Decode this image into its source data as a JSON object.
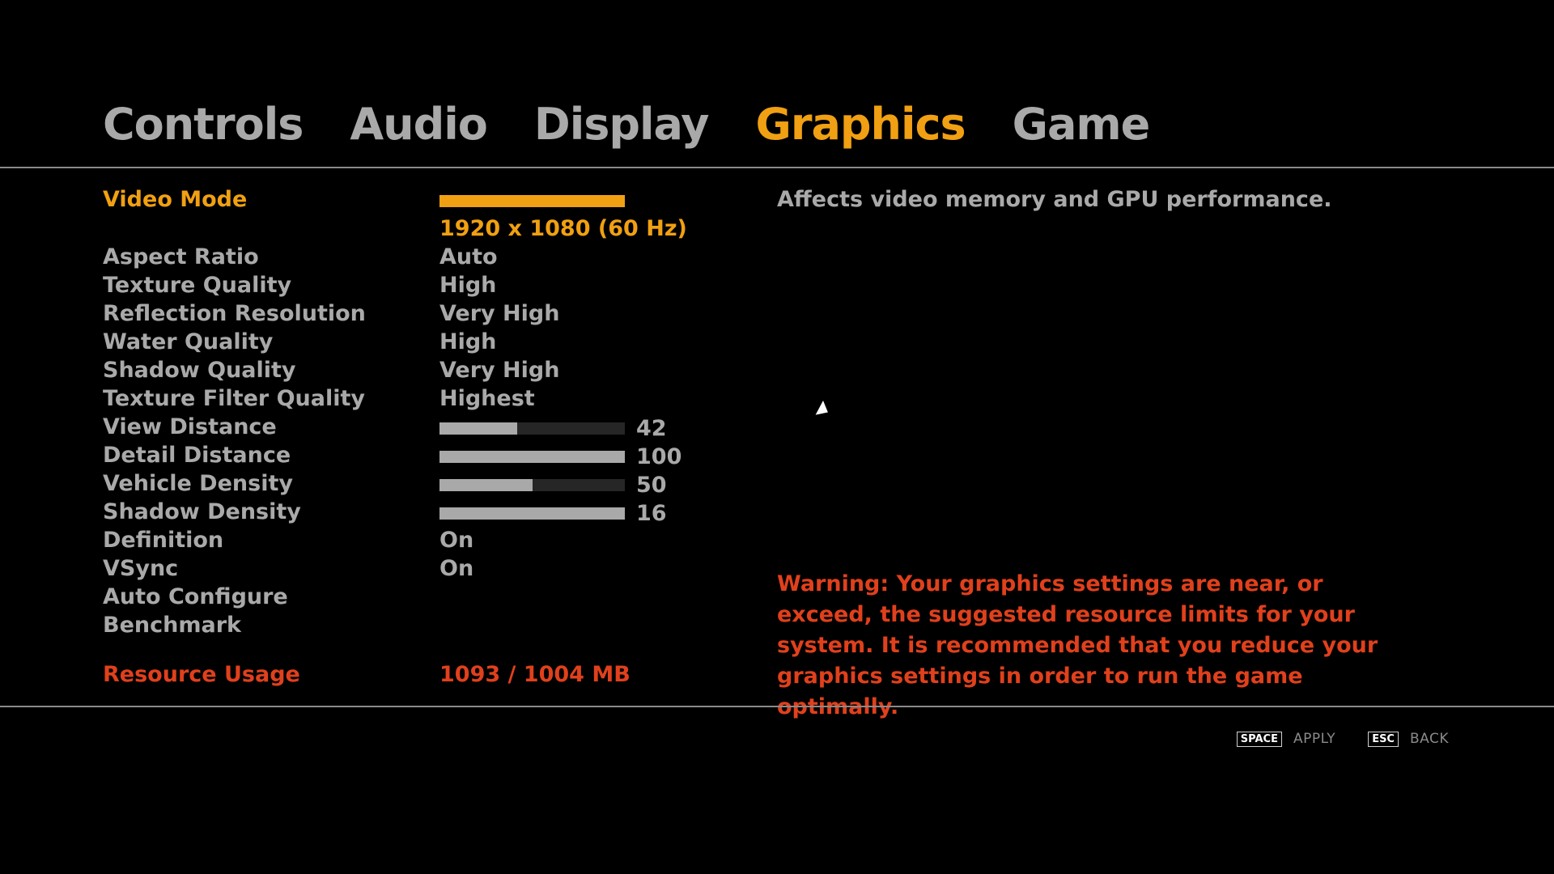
{
  "tabs": [
    {
      "label": "Controls",
      "active": false
    },
    {
      "label": "Audio",
      "active": false
    },
    {
      "label": "Display",
      "active": false
    },
    {
      "label": "Graphics",
      "active": true
    },
    {
      "label": "Game",
      "active": false
    }
  ],
  "settings": {
    "video_mode": {
      "label": "Video Mode",
      "value": "1920 x 1080 (60 Hz)"
    },
    "aspect_ratio": {
      "label": "Aspect Ratio",
      "value": "Auto"
    },
    "texture_quality": {
      "label": "Texture Quality",
      "value": "High"
    },
    "reflection_resolution": {
      "label": "Reflection Resolution",
      "value": "Very High"
    },
    "water_quality": {
      "label": "Water Quality",
      "value": "High"
    },
    "shadow_quality": {
      "label": "Shadow Quality",
      "value": "Very High"
    },
    "texture_filter_quality": {
      "label": "Texture Filter Quality",
      "value": "Highest"
    },
    "view_distance": {
      "label": "View Distance",
      "value": "42",
      "level": 0.42
    },
    "detail_distance": {
      "label": "Detail Distance",
      "value": "100",
      "level": 1.0
    },
    "vehicle_density": {
      "label": "Vehicle Density",
      "value": "50",
      "level": 0.5
    },
    "shadow_density": {
      "label": "Shadow Density",
      "value": "16",
      "level": 1.0
    },
    "definition": {
      "label": "Definition",
      "value": "On"
    },
    "vsync": {
      "label": "VSync",
      "value": "On"
    },
    "auto_configure": {
      "label": "Auto Configure"
    },
    "benchmark": {
      "label": "Benchmark"
    },
    "resource_usage": {
      "label": "Resource Usage",
      "value": "1093 / 1004 MB"
    }
  },
  "description": "Affects video memory and GPU performance.",
  "warning": "Warning: Your graphics settings are near, or exceed, the suggested resource limits for your system. It is recommended that you reduce your graphics settings in order to run the game optimally.",
  "footer": {
    "apply_key": "SPACE",
    "apply_label": "APPLY",
    "back_key": "ESC",
    "back_label": "BACK"
  },
  "colors": {
    "accent": "#f0a012",
    "warning": "#e0401c",
    "text": "#a9a9a9",
    "background": "#000000"
  },
  "icons": {
    "cursor": "mouse-pointer-icon"
  }
}
